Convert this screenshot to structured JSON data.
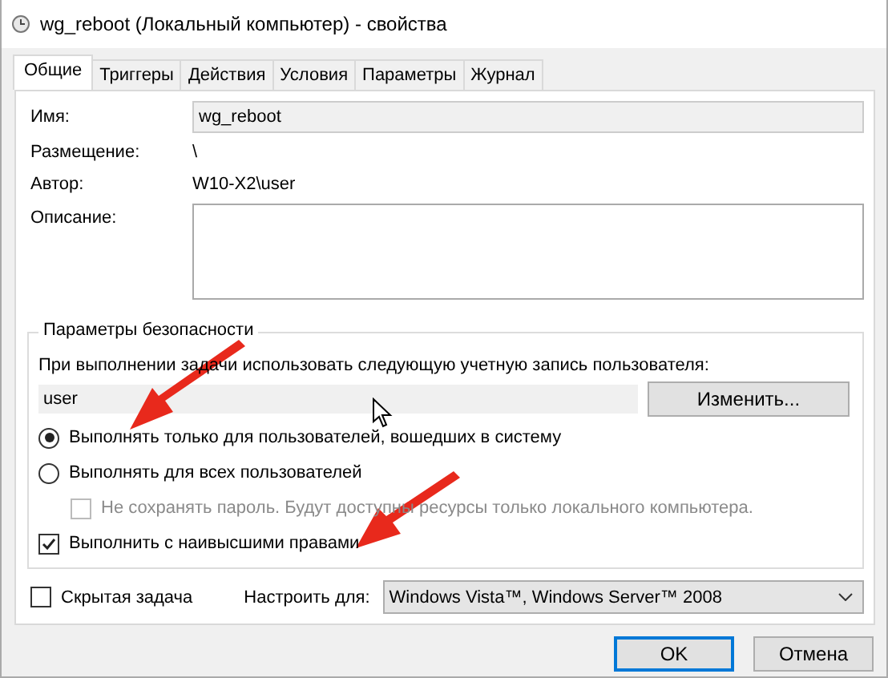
{
  "window": {
    "title": "wg_reboot (Локальный компьютер) - свойства"
  },
  "tabs": [
    {
      "label": "Общие",
      "selected": true
    },
    {
      "label": "Триггеры",
      "selected": false
    },
    {
      "label": "Действия",
      "selected": false
    },
    {
      "label": "Условия",
      "selected": false
    },
    {
      "label": "Параметры",
      "selected": false
    },
    {
      "label": "Журнал",
      "selected": false
    }
  ],
  "general": {
    "name_label": "Имя:",
    "name_value": "wg_reboot",
    "location_label": "Размещение:",
    "location_value": "\\",
    "author_label": "Автор:",
    "author_value": "W10-X2\\user",
    "description_label": "Описание:"
  },
  "security": {
    "title": "Параметры безопасности",
    "account_prompt": "При выполнении задачи использовать следующую учетную запись пользователя:",
    "account_value": "user",
    "change_button": "Изменить...",
    "options": [
      {
        "kind": "radio",
        "label": "Выполнять только для пользователей, вошедших в систему",
        "selected": true
      },
      {
        "kind": "radio",
        "label": "Выполнять для всех пользователей",
        "selected": false
      },
      {
        "kind": "sub_checkbox",
        "label": "Не сохранять пароль. Будут доступны ресурсы только локального компьютера.",
        "checked": false,
        "disabled": true
      },
      {
        "kind": "checkbox",
        "label": "Выполнить с наивысшими правами",
        "checked": true,
        "disabled": false
      }
    ]
  },
  "hidden_task": {
    "label": "Скрытая задача",
    "checked": false
  },
  "configure_for": {
    "label": "Настроить для:",
    "value": "Windows Vista™, Windows Server™ 2008"
  },
  "buttons": [
    {
      "label": "OK",
      "default": true
    },
    {
      "label": "Отмена",
      "default": false
    }
  ]
}
